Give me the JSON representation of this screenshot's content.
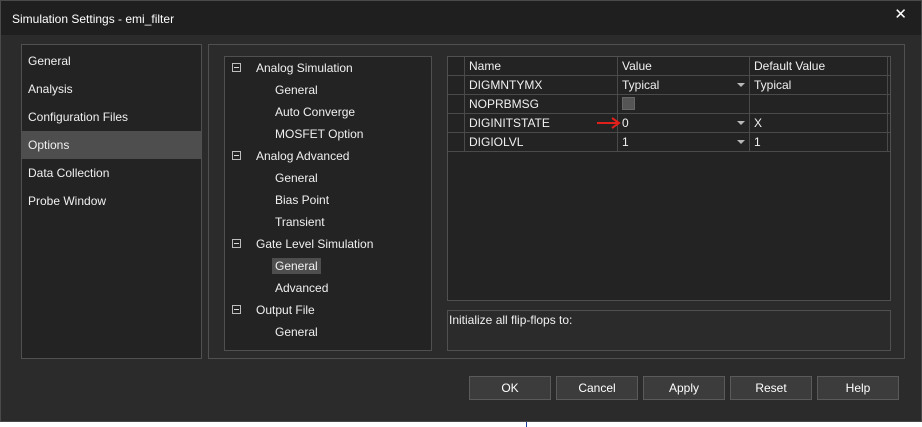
{
  "window": {
    "title": "Simulation Settings - emi_filter",
    "close_glyph": "✕"
  },
  "categories": [
    {
      "label": "General",
      "selected": false
    },
    {
      "label": "Analysis",
      "selected": false
    },
    {
      "label": "Configuration Files",
      "selected": false
    },
    {
      "label": "Options",
      "selected": true
    },
    {
      "label": "Data Collection",
      "selected": false
    },
    {
      "label": "Probe Window",
      "selected": false
    }
  ],
  "tree": [
    {
      "label": "Analog Simulation",
      "children": [
        "General",
        "Auto Converge",
        "MOSFET Option"
      ]
    },
    {
      "label": "Analog Advanced",
      "children": [
        "General",
        "Bias Point",
        "Transient"
      ]
    },
    {
      "label": "Gate Level Simulation",
      "children": [
        "General",
        "Advanced"
      ],
      "selected_child": "General"
    },
    {
      "label": "Output File",
      "children": [
        "General"
      ]
    }
  ],
  "grid": {
    "headers": [
      "Name",
      "Value",
      "Default Value"
    ],
    "rows": [
      {
        "name": "DIGMNTYMX",
        "value": "Typical",
        "default": "Typical",
        "type": "dropdown"
      },
      {
        "name": "NOPRBMSG",
        "value": "",
        "default": "",
        "type": "checkbox"
      },
      {
        "name": "DIGINITSTATE",
        "value": "0",
        "default": "X",
        "type": "dropdown",
        "annotated": true
      },
      {
        "name": "DIGIOLVL",
        "value": "1",
        "default": "1",
        "type": "dropdown"
      }
    ]
  },
  "description": "Initialize all flip-flops to:",
  "buttons": {
    "ok": "OK",
    "cancel": "Cancel",
    "apply": "Apply",
    "reset": "Reset",
    "help": "Help"
  },
  "colors": {
    "background": "#2b2b2b",
    "panel": "#232323",
    "selection": "#4e4e4e",
    "annotation_arrow": "#e0201b"
  },
  "icons": {
    "close": "close-icon",
    "collapse": "minus-box-icon",
    "dropdown": "chevron-down-icon",
    "annotation": "red-arrow-icon"
  }
}
